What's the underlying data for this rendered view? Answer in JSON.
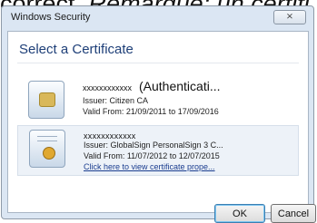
{
  "background_text": {
    "plain": "correct.",
    "italic": "Remarque: un certifi"
  },
  "window": {
    "title": "Windows Security",
    "close_label": "⨯"
  },
  "dialog": {
    "heading": "Select a Certificate"
  },
  "certificates": [
    {
      "name": "xxxxxxxxxxxx",
      "name_suffix": "(Authenticati...",
      "issuer": "Issuer: Citizen CA",
      "valid": "Valid From: 21/09/2011 to 17/09/2016",
      "icon": "smartcard-certificate-icon"
    },
    {
      "name": "xxxxxxxxxxxx",
      "issuer": "Issuer: GlobalSign PersonalSign 3 C...",
      "valid": "Valid From: 11/07/2012 to 12/07/2015",
      "link": "Click here to view certificate prope...",
      "icon": "certificate-seal-icon"
    }
  ],
  "buttons": {
    "ok": "OK",
    "cancel": "Cancel"
  },
  "colors": {
    "heading": "#1e3f78",
    "frame": "#dbe6f3",
    "selected_row": "#edf2f8",
    "link": "#1a3d8f"
  }
}
